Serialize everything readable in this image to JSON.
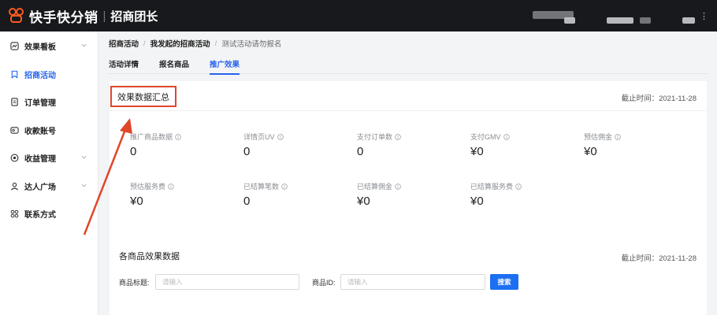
{
  "topbar": {
    "brand": "快手快分销",
    "separator": "|",
    "subbrand": "招商团长",
    "icon": "ellipsis-icon"
  },
  "sidebar": {
    "items": [
      {
        "label": "效果看板",
        "icon": "chart-icon",
        "has_chevron": true
      },
      {
        "label": "招商活动",
        "icon": "bookmark-icon",
        "active": true
      },
      {
        "label": "订单管理",
        "icon": "document-icon"
      },
      {
        "label": "收款账号",
        "icon": "wallet-icon"
      },
      {
        "label": "收益管理",
        "icon": "coin-icon",
        "has_chevron": true
      },
      {
        "label": "达人广场",
        "icon": "person-icon",
        "has_chevron": true
      },
      {
        "label": "联系方式",
        "icon": "grid-icon"
      }
    ]
  },
  "breadcrumb": {
    "item1": "招商活动",
    "item2": "我发起的招商活动",
    "item3": "测试活动请勿报名",
    "separator": "/"
  },
  "tabs": [
    {
      "label": "活动详情"
    },
    {
      "label": "报名商品"
    },
    {
      "label": "推广效果",
      "active": true
    }
  ],
  "summary": {
    "title": "效果数据汇总",
    "deadline": "截止时间：2021-11-28",
    "stats": [
      {
        "label": "推广商品数据",
        "value": "0"
      },
      {
        "label": "详情页UV",
        "value": "0"
      },
      {
        "label": "支付订单数",
        "value": "0"
      },
      {
        "label": "支付GMV",
        "value": "¥0"
      },
      {
        "label": "预估佣金",
        "value": "¥0"
      },
      {
        "label": "预估服务费",
        "value": "¥0"
      },
      {
        "label": "已结算笔数",
        "value": "0"
      },
      {
        "label": "已结算佣金",
        "value": "¥0"
      },
      {
        "label": "已结算服务费",
        "value": "¥0"
      }
    ]
  },
  "products": {
    "title": "各商品效果数据",
    "deadline": "截止时间：2021-11-28",
    "title_label": "商品标题:",
    "title_placeholder": "请输入",
    "id_label": "商品ID:",
    "id_placeholder": "请输入",
    "search_label": "搜索"
  },
  "colors": {
    "accent": "#2563eb",
    "brand": "#ff5a1f",
    "highlight": "#e0462a",
    "topbar": "#17191d"
  }
}
